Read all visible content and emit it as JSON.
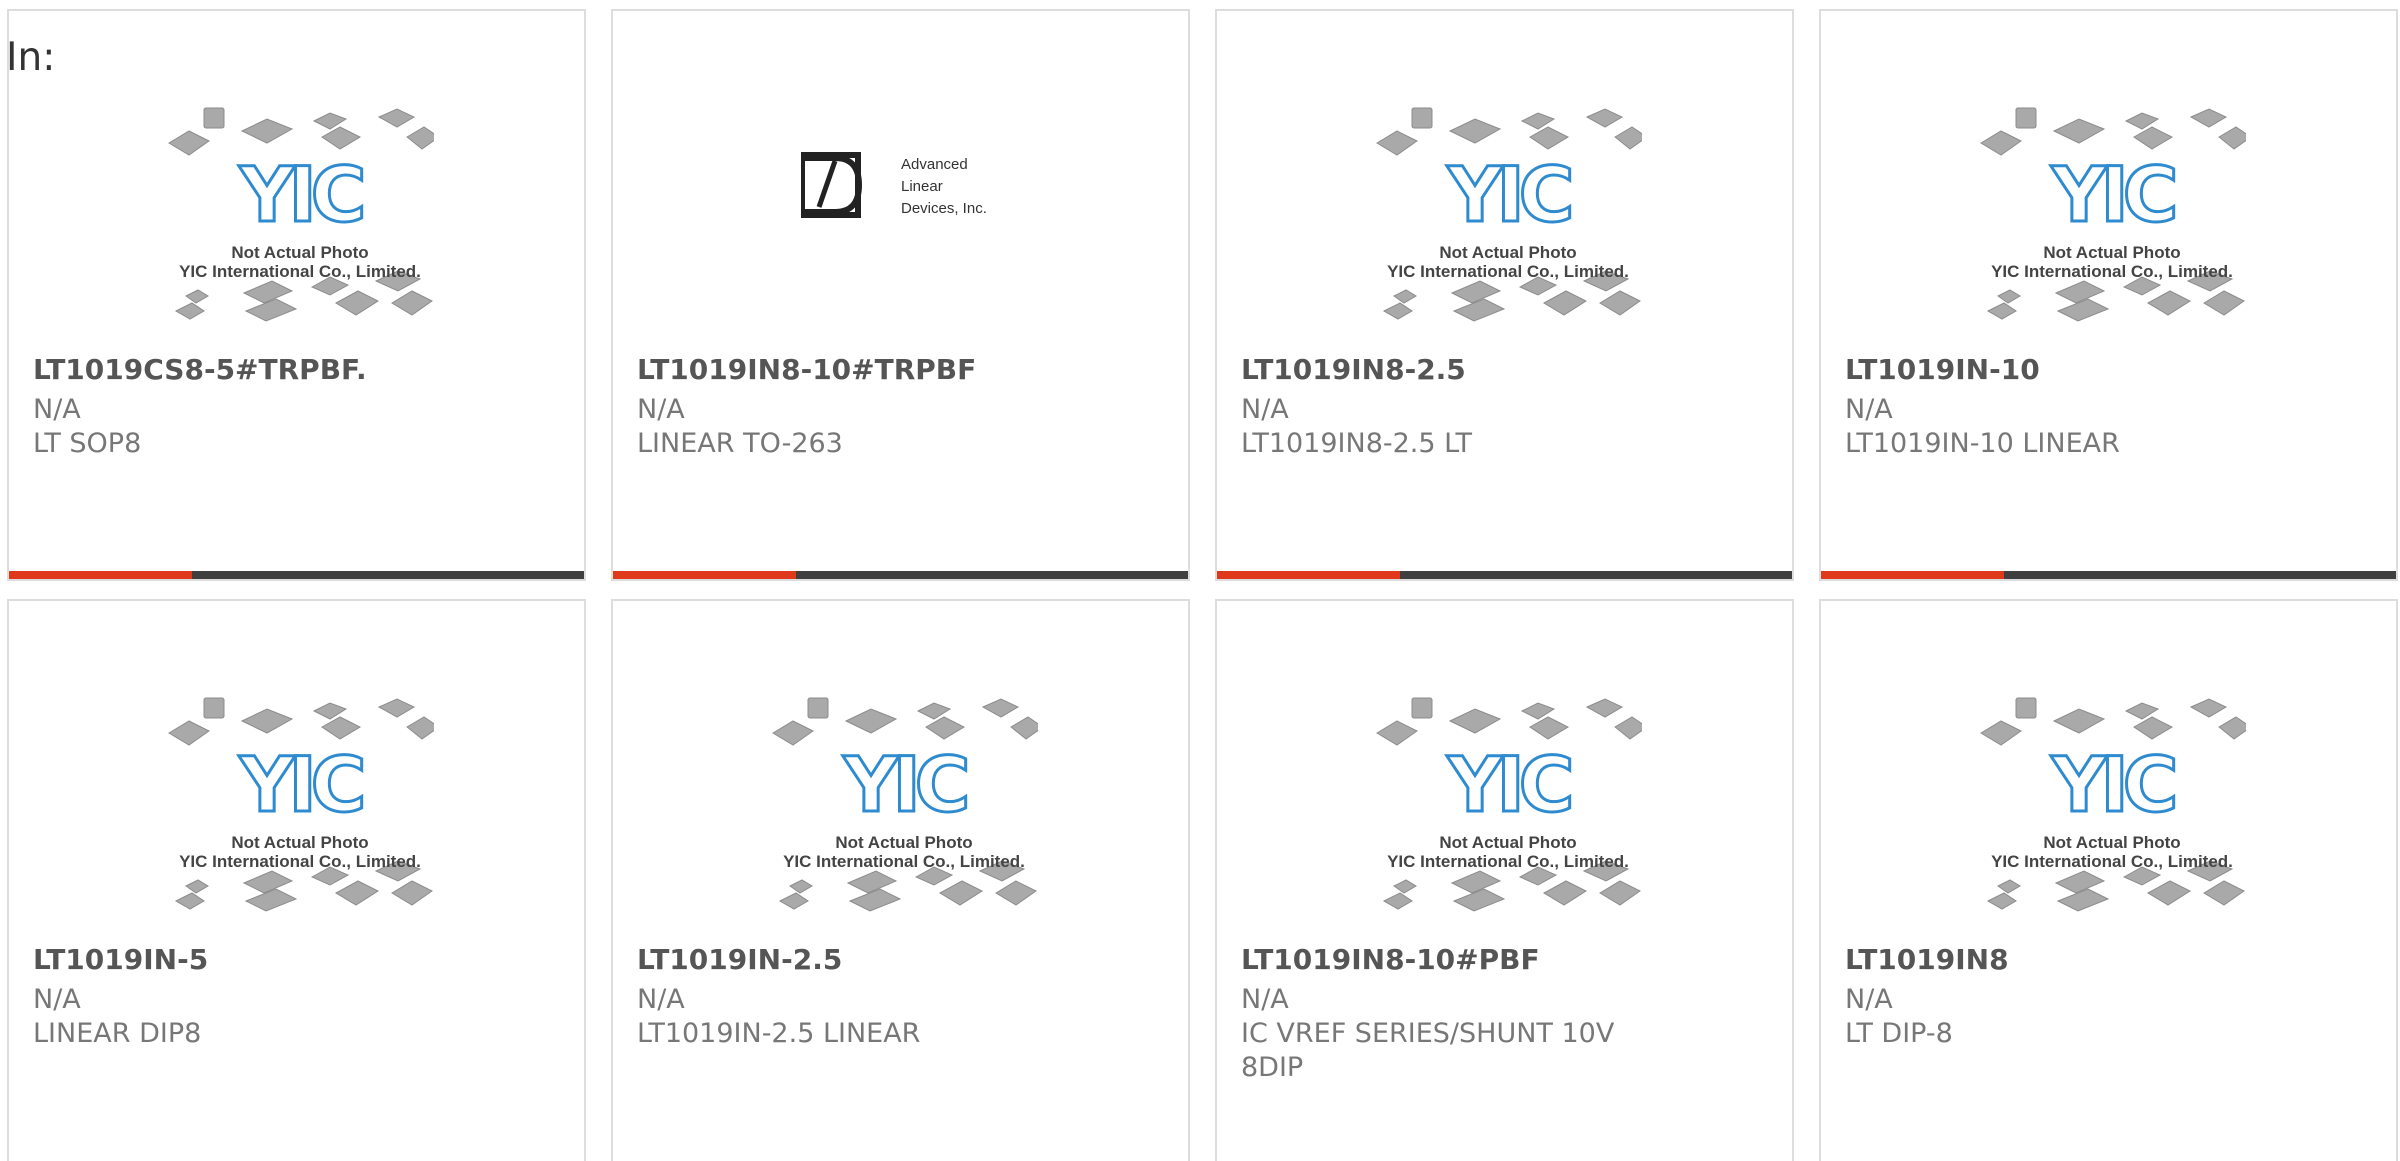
{
  "header": {
    "label": "In:"
  },
  "thumb_text": {
    "line1": "Not Actual Photo",
    "line2": "YIC International Co., Limited.",
    "brand": "YIC"
  },
  "adi_logo": {
    "line1": "Advanced",
    "line2": "Linear",
    "line3": "Devices, Inc."
  },
  "accent_color": "#e0381a",
  "products": [
    {
      "part": "LT1019CS8-5#TRPBF.",
      "price": "N/A",
      "desc": "LT SOP8",
      "image": "yic-placeholder"
    },
    {
      "part": "LT1019IN8-10#TRPBF",
      "price": "N/A",
      "desc": "LINEAR TO-263",
      "image": "adi-logo"
    },
    {
      "part": "LT1019IN8-2.5",
      "price": "N/A",
      "desc": "LT1019IN8-2.5 LT",
      "image": "yic-placeholder"
    },
    {
      "part": "LT1019IN-10",
      "price": "N/A",
      "desc": "LT1019IN-10 LINEAR",
      "image": "yic-placeholder"
    },
    {
      "part": "LT1019IN-5",
      "price": "N/A",
      "desc": "LINEAR DIP8",
      "image": "yic-placeholder"
    },
    {
      "part": "LT1019IN-2.5",
      "price": "N/A",
      "desc": "LT1019IN-2.5 LINEAR",
      "image": "yic-placeholder"
    },
    {
      "part": "LT1019IN8-10#PBF",
      "price": "N/A",
      "desc": "IC VREF SERIES/SHUNT 10V 8DIP",
      "image": "yic-placeholder"
    },
    {
      "part": "LT1019IN8",
      "price": "N/A",
      "desc": "LT DIP-8",
      "image": "yic-placeholder"
    }
  ]
}
